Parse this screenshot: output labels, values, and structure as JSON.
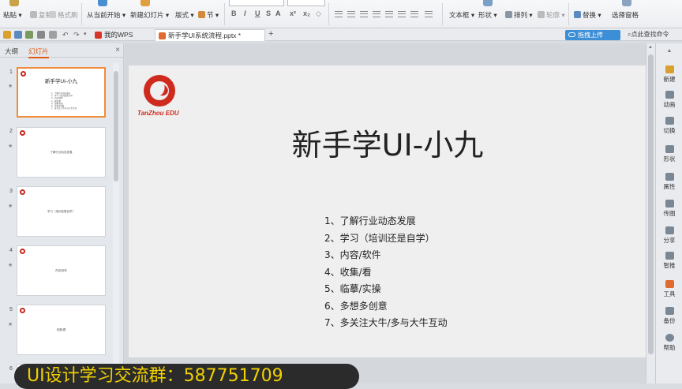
{
  "ribbon": {
    "paste": "粘贴",
    "copy": "复制",
    "format_painter": "格式刷",
    "from_current": "从当前开始",
    "new_slide": "新建幻灯片",
    "layout": "版式",
    "section": "节",
    "format_buttons": [
      "B",
      "I",
      "U",
      "S",
      "A",
      "x²",
      "x₂"
    ],
    "textbox": "文本框",
    "shape": "形状",
    "arrange": "排列",
    "outline": "轮廓",
    "replace": "替换",
    "select_pane": "选择窗格"
  },
  "tabbar": {
    "tabs": [
      {
        "label": "我的WPS"
      },
      {
        "label": "新手学UI系统流程.pptx *"
      }
    ],
    "new_tab": "+",
    "upload_label": "拖拽上传",
    "command_search": "点此查找命令"
  },
  "left_pane": {
    "tab_outline": "大纲",
    "tab_slides": "幻灯片",
    "close": "×",
    "thumbnails": [
      {
        "num": "1",
        "title": "新手学UI-小九",
        "selected": true
      },
      {
        "num": "2",
        "text": "了解行业动态发展"
      },
      {
        "num": "3",
        "text": "学习（培训还是自学）"
      },
      {
        "num": "4",
        "text": "内容/软件"
      },
      {
        "num": "5",
        "text": "收集/看"
      },
      {
        "num": "6"
      }
    ]
  },
  "slide": {
    "logo_text": "TanZhou EDU",
    "title": "新手学UI-小九",
    "items": [
      "1、了解行业动态发展",
      "2、学习（培训还是自学）",
      "3、内容/软件",
      "4、收集/看",
      "5、临摹/实操",
      "6、多想多创意",
      "7、多关注大牛/多与大牛互动"
    ]
  },
  "right_bar": {
    "buttons": [
      "新建",
      "动画",
      "切换",
      "形状",
      "属性",
      "传图",
      "分享",
      "智推",
      "工具",
      "备份",
      "帮助"
    ]
  },
  "banner": {
    "text": "UI设计学习交流群：587751709"
  },
  "colors": {
    "accent_orange": "#e05a14",
    "logo_red": "#cf2a1e",
    "banner_bg": "#2b2b2b",
    "banner_text": "#f0d000",
    "upload_blue": "#3c8fd6"
  }
}
